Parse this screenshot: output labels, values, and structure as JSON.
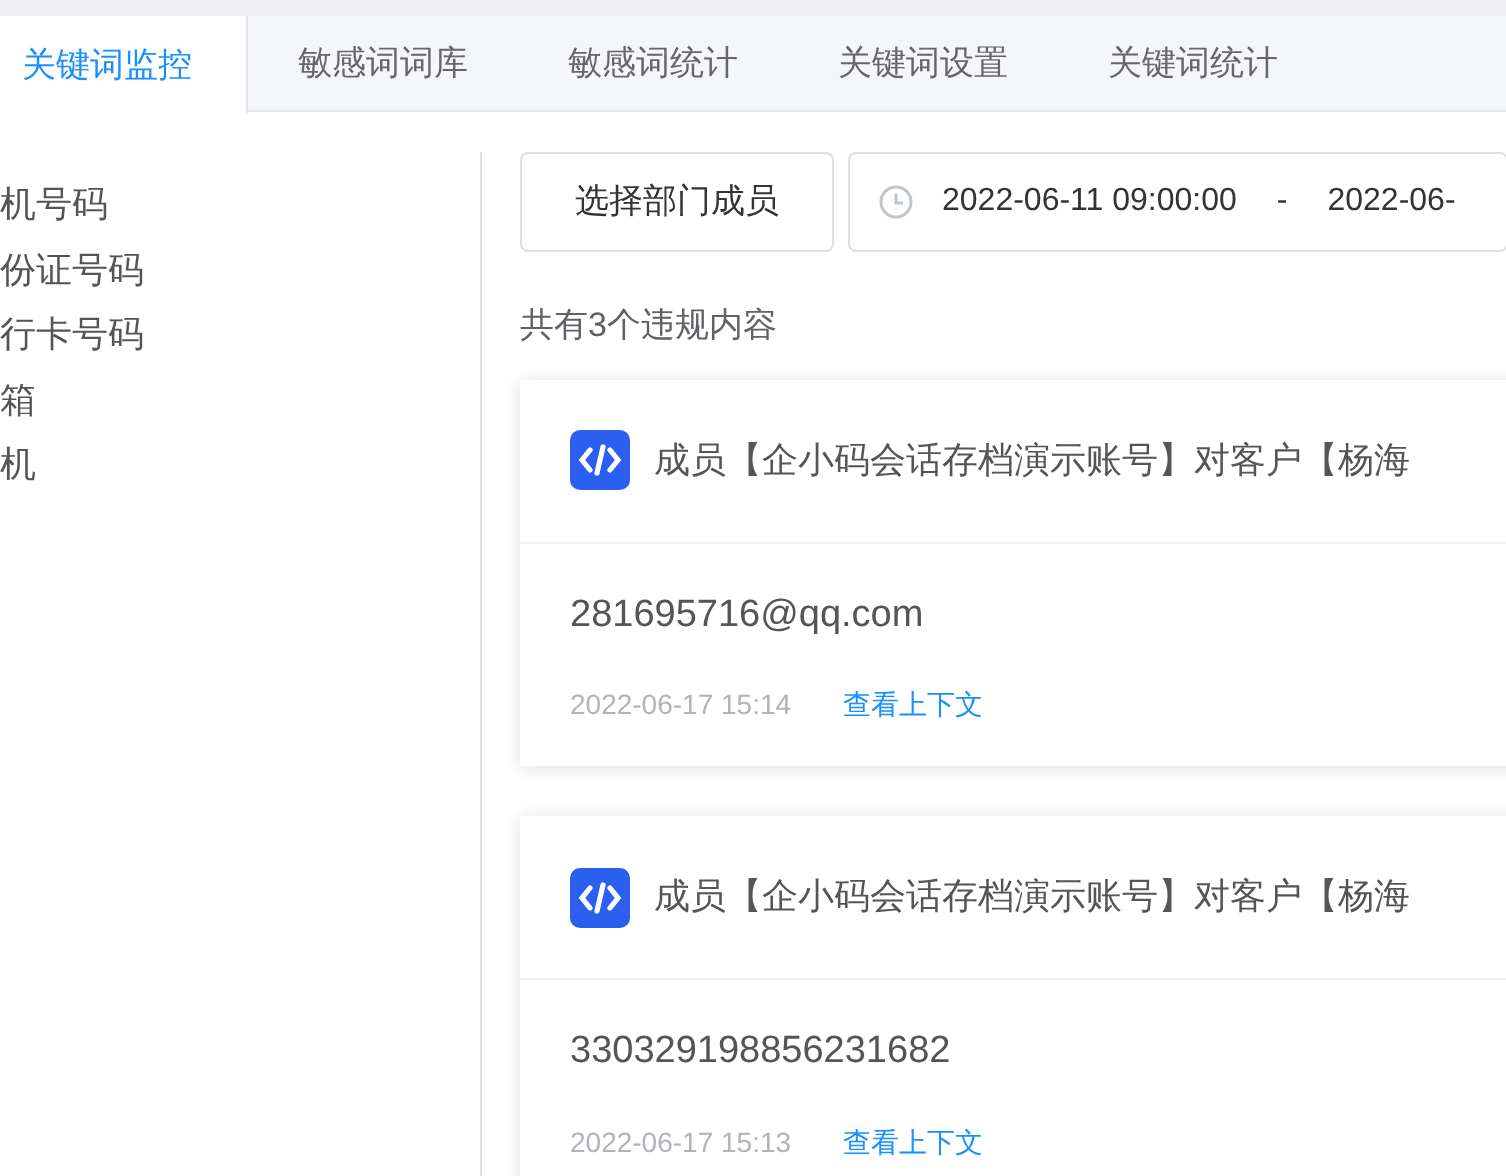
{
  "tabs": [
    {
      "label": "关键词监控",
      "selected": true
    },
    {
      "label": "敏感词词库",
      "selected": false
    },
    {
      "label": "敏感词统计",
      "selected": false
    },
    {
      "label": "关键词设置",
      "selected": false
    },
    {
      "label": "关键词统计",
      "selected": false
    }
  ],
  "sidebar": {
    "items": [
      "机号码",
      "份证号码",
      "行卡号码",
      "箱",
      "机"
    ]
  },
  "filters": {
    "member_button": "选择部门成员",
    "date_start": "2022-06-11 09:00:00",
    "separator": "-",
    "date_end": "2022-06-"
  },
  "summary": "共有3个违规内容",
  "records": [
    {
      "title": "成员【企小码会话存档演示账号】对客户【杨海",
      "content": "281695716@qq.com",
      "time": "2022-06-17 15:14",
      "link": "查看上下文"
    },
    {
      "title": "成员【企小码会话存档演示账号】对客户【杨海",
      "content": "330329198856231682",
      "time": "2022-06-17 15:13",
      "link": "查看上下文"
    }
  ]
}
